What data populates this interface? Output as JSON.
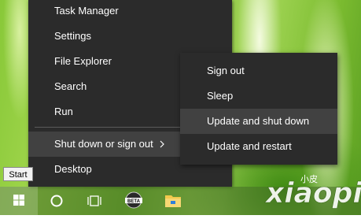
{
  "menu": {
    "items": [
      {
        "label": "Task Manager"
      },
      {
        "label": "Settings"
      },
      {
        "label": "File Explorer"
      },
      {
        "label": "Search"
      },
      {
        "label": "Run"
      },
      {
        "label": "Shut down or sign out"
      },
      {
        "label": "Desktop"
      }
    ]
  },
  "submenu": {
    "items": [
      {
        "label": "Sign out"
      },
      {
        "label": "Sleep"
      },
      {
        "label": "Update and shut down"
      },
      {
        "label": "Update and restart"
      }
    ]
  },
  "tooltip": {
    "text": "Start"
  },
  "taskbar": {
    "icons": [
      "windows-logo-icon",
      "cortana-icon",
      "task-view-icon",
      "beta-app-icon",
      "file-explorer-icon"
    ],
    "beta_label": "BETA"
  },
  "watermark": {
    "text": "xiaopi",
    "small_text": "小皮"
  },
  "colors": {
    "menu_bg": "#2b2b2b",
    "menu_hover": "#414141",
    "accent": "#ffffff"
  }
}
